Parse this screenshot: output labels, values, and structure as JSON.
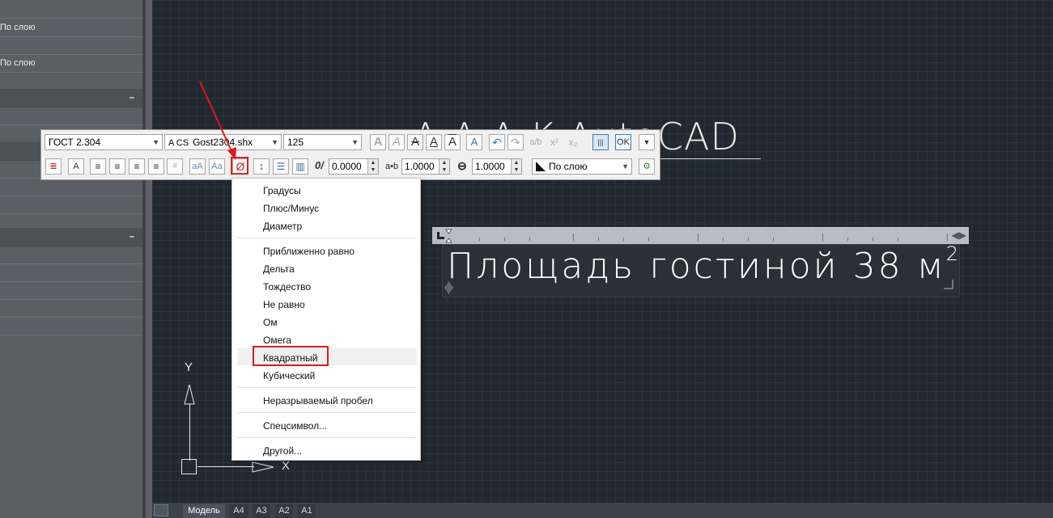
{
  "props": {
    "rows": [
      {
        "value": ""
      },
      {
        "value": "По слою"
      },
      {
        "value": ""
      },
      {
        "value": "По слою"
      },
      {
        "value": ""
      }
    ],
    "header_minus": "–"
  },
  "drawing": {
    "bg_text": "A    A  A  K AutoCAD",
    "mtext_main": "Площадь гостиной 38 м",
    "mtext_sup": "2"
  },
  "ucs": {
    "y": "Y",
    "x": "X"
  },
  "toolbar": {
    "style": "ГОСТ 2.304",
    "font_prefix": "A CS",
    "font": "Gost2304.shx",
    "height": "125",
    "ok": "OK",
    "oblique_value": "0.0000",
    "tracking_label": "a•b",
    "tracking_value": "1.0000",
    "width_value": "1.0000",
    "color": "По слою",
    "icons": {
      "bold": "bold-icon",
      "italic": "italic-icon",
      "strike": "strikethrough-icon",
      "underline": "underline-icon",
      "overline": "overline-icon",
      "undo": "undo-icon",
      "redo": "redo-icon",
      "symbol": "symbol-icon"
    }
  },
  "menu": {
    "items": [
      "Градусы",
      "Плюс/Минус",
      "Диаметр",
      "Приближенно равно",
      "Дельта",
      "Тождество",
      "Не равно",
      "Ом",
      "Омега",
      "Квадратный",
      "Кубический",
      "Неразрываемый пробел",
      "Спецсимвол...",
      "Другой..."
    ],
    "highlighted": "Квадратный"
  },
  "tabs": {
    "items": [
      "Модель",
      "A4",
      "A3",
      "A2",
      "A1"
    ],
    "active": "Модель"
  },
  "colors": {
    "canvas": "#212830",
    "accent_red": "#e01818",
    "menu_bg": "#ffffff"
  }
}
